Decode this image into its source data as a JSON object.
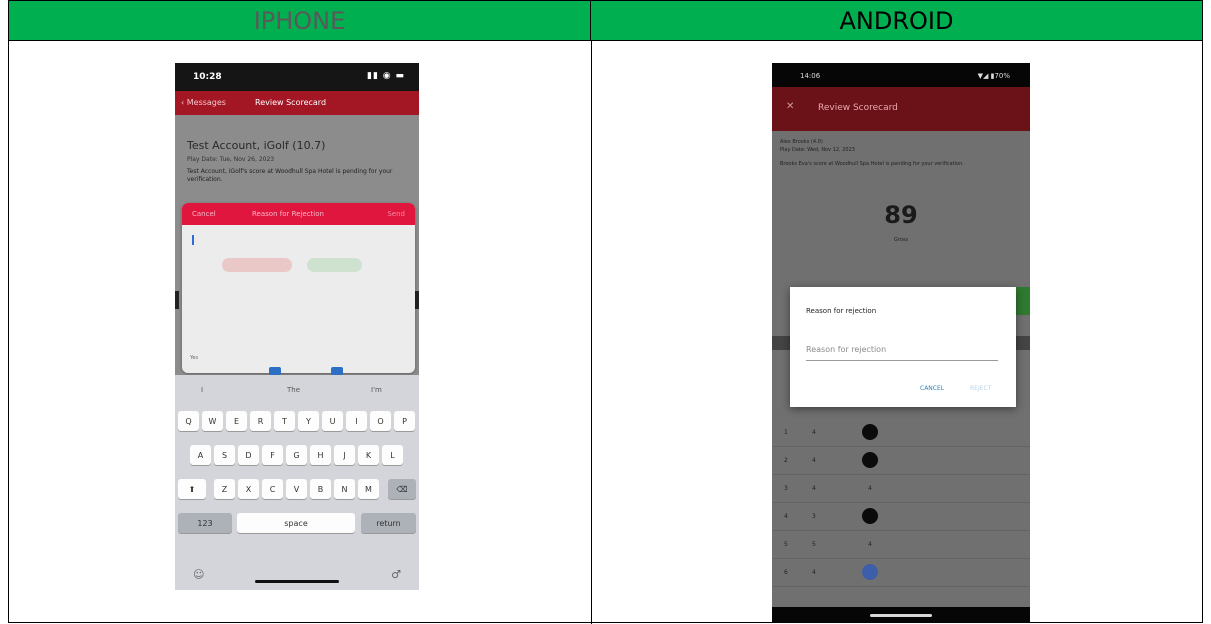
{
  "table": {
    "headers": [
      "IPHONE",
      "ANDROID"
    ],
    "header_bg": "#00b050"
  },
  "iphone": {
    "status_time": "10:28",
    "status_icons": "▮▮ ◉ ▬",
    "nav_back": "‹ Messages",
    "nav_title": "Review Scorecard",
    "player_name": "Test Account, iGolf (10.7)",
    "play_date": "Play Date: Tue, Nov 26, 2023",
    "description": "Test Account, iGolf's score at Woodhull Spa Hotel is pending for your verification.",
    "sheet": {
      "cancel": "Cancel",
      "title": "Reason for Rejection",
      "send": "Send",
      "footer": "Yes"
    },
    "keyboard": {
      "suggestions": [
        "I",
        "The",
        "I'm"
      ],
      "row1": [
        "Q",
        "W",
        "E",
        "R",
        "T",
        "Y",
        "U",
        "I",
        "O",
        "P"
      ],
      "row2": [
        "A",
        "S",
        "D",
        "F",
        "G",
        "H",
        "J",
        "K",
        "L"
      ],
      "row3": [
        "Z",
        "X",
        "C",
        "V",
        "B",
        "N",
        "M"
      ],
      "shift": "⬆",
      "delete": "⌫",
      "numbers": "123",
      "space": "space",
      "return": "return",
      "globe_icon": "☺",
      "mic_icon": "♂"
    }
  },
  "android": {
    "status_time": "14:06",
    "status_icons": "▼◢ ▮70%",
    "back_icon": "✕",
    "title": "Review Scorecard",
    "player_name": "Alex Brooks (4.0)",
    "play_date": "Play Date: Wed, Nov 12, 2023",
    "description": "Brooks Eva's score at Woodhull Spa Hotel is pending for your verification.",
    "score": "89",
    "score_label": "Gross",
    "dialog": {
      "title": "Reason for rejection",
      "placeholder": "Reason for rejection",
      "cancel": "CANCEL",
      "reject": "REJECT"
    },
    "rows": [
      {
        "hole": "1",
        "par": "4",
        "mark": "•"
      },
      {
        "hole": "2",
        "par": "4",
        "mark": "•"
      },
      {
        "hole": "3",
        "par": "4",
        "mark": "4"
      },
      {
        "hole": "4",
        "par": "3",
        "mark": "•"
      },
      {
        "hole": "5",
        "par": "5",
        "mark": "4"
      },
      {
        "hole": "6",
        "par": "4",
        "mark": "•"
      }
    ]
  }
}
